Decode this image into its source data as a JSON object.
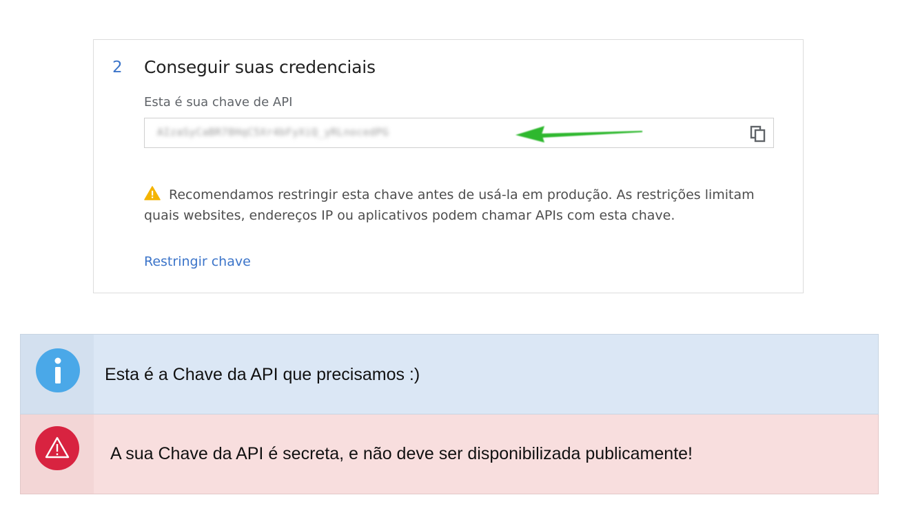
{
  "card": {
    "step_number": "2",
    "title": "Conseguir suas credenciais",
    "key_label": "Esta é sua chave de API",
    "key_value": "AIzaSyCaBR78HqC5Xr4bFyXiQ_yRLnocedPG",
    "copy_icon": "copy-icon",
    "warning_text": "Recomendamos restringir esta chave antes de usá-la em produção. As restrições limitam quais websites, endereços IP ou aplicativos podem chamar APIs com esta chave.",
    "restrict_link": "Restringir chave",
    "link_color": "#3b74c9",
    "arrow_color": "#2eb82e"
  },
  "callouts": {
    "info": {
      "icon": "info-icon",
      "text": "Esta é a Chave da API que precisamos :)",
      "background": "#dbe7f5",
      "icon_color": "#4aa8e8"
    },
    "danger": {
      "icon": "warning-triangle-icon",
      "text": "A sua Chave da API é secreta, e não deve ser disponibilizada publicamente!",
      "background": "#f8dede",
      "icon_color": "#d82340"
    }
  }
}
